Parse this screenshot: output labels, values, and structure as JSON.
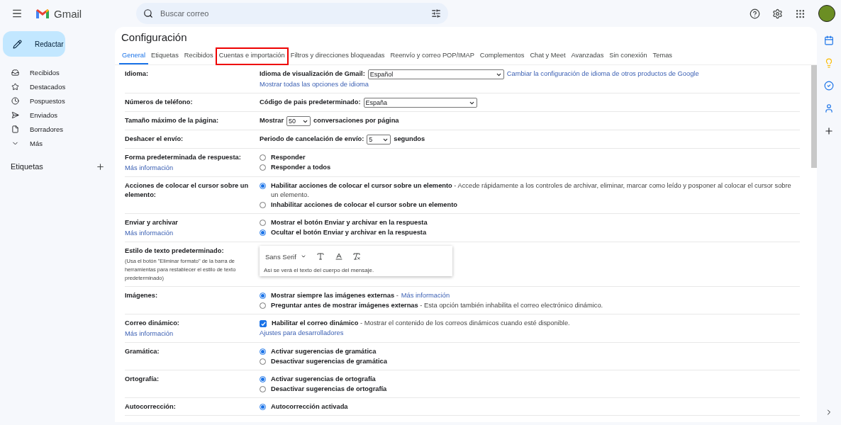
{
  "topbar": {
    "brand": "Gmail",
    "search": {
      "placeholder": "Buscar correo"
    }
  },
  "sidebar": {
    "compose": "Redactar",
    "items": [
      {
        "label": "Recibidos",
        "selected": false
      },
      {
        "label": "Destacados",
        "selected": false
      },
      {
        "label": "Pospuestos",
        "selected": false
      },
      {
        "label": "Enviados",
        "selected": false
      },
      {
        "label": "Borradores",
        "selected": false
      },
      {
        "label": "Más",
        "selected": false
      }
    ],
    "labels_heading": "Etiquetas"
  },
  "settings": {
    "title": "Configuración",
    "tabs": [
      {
        "label": "General",
        "selected": true,
        "highlighted": false
      },
      {
        "label": "Etiquetas",
        "selected": false,
        "highlighted": false
      },
      {
        "label": "Recibidos",
        "selected": false,
        "highlighted": false
      },
      {
        "label": "Cuentas e importación",
        "selected": false,
        "highlighted": true
      },
      {
        "label": "Filtros y direcciones bloqueadas",
        "selected": false,
        "highlighted": false
      },
      {
        "label": "Reenvío y correo POP/IMAP",
        "selected": false,
        "highlighted": false
      },
      {
        "label": "Complementos",
        "selected": false,
        "highlighted": false
      },
      {
        "label": "Chat y Meet",
        "selected": false,
        "highlighted": false
      },
      {
        "label": "Avanzadas",
        "selected": false,
        "highlighted": false
      },
      {
        "label": "Sin conexión",
        "selected": false,
        "highlighted": false
      },
      {
        "label": "Temas",
        "selected": false,
        "highlighted": false
      }
    ],
    "rows": [
      {
        "label": "Idioma:",
        "items": [
          {
            "kind": "select",
            "label": "Idioma de visualización de Gmail:",
            "value": "Español",
            "link": "Cambiar la configuración de idioma de otros productos de Google"
          },
          {
            "kind": "link",
            "text": "Mostrar todas las opciones de idioma"
          }
        ]
      },
      {
        "label": "Números de teléfono:",
        "items": [
          {
            "kind": "select",
            "label": "Código de pais predeterminado:",
            "value": "España"
          }
        ]
      },
      {
        "label": "Tamaño máximo de la página:",
        "items": [
          {
            "kind": "select",
            "label": "Mostrar",
            "value": "50",
            "suffix": "conversaciones por página"
          }
        ]
      },
      {
        "label": "Deshacer el envío:",
        "items": [
          {
            "kind": "select",
            "label": "Periodo de cancelación de envío:",
            "value": "5",
            "suffix": "segundos"
          }
        ]
      },
      {
        "label": "Forma predeterminada de respuesta:",
        "link": "Más información",
        "items": [
          {
            "kind": "radio",
            "label": "Responder",
            "selected": false
          },
          {
            "kind": "radio",
            "label": "Responder a todos",
            "selected": false
          }
        ]
      },
      {
        "label": "Acciones de colocar el cursor sobre un elemento:",
        "items": [
          {
            "kind": "radio",
            "label": "Habilitar acciones de colocar el cursor sobre un elemento",
            "description": "- Accede rápidamente a los controles de archivar, eliminar, marcar como leído y posponer al colocar el cursor sobre un elemento.",
            "selected": true
          },
          {
            "kind": "radio",
            "label": "Inhabilitar acciones de colocar el cursor sobre un elemento",
            "selected": false
          }
        ]
      },
      {
        "label": "Enviar y archivar",
        "link": "Más información",
        "items": [
          {
            "kind": "radio",
            "label": "Mostrar el botón Enviar y archivar en la respuesta",
            "selected": false
          },
          {
            "kind": "radio",
            "label": "Ocultar el botón Enviar y archivar en la respuesta",
            "selected": true
          }
        ]
      },
      {
        "label": "Estilo de texto predeterminado:",
        "note": "(Usa el botón \"Eliminar formato\" de la barra de herramientas para restablecer el estilo de texto predeterminado)",
        "items": [
          {
            "kind": "editor",
            "font": "Sans Serif",
            "sample": "Así se verá el texto del cuerpo del mensaje."
          }
        ]
      },
      {
        "label": "Imágenes:",
        "items": [
          {
            "kind": "radio",
            "label": "Mostrar siempre las imágenes externas",
            "description": "-",
            "link": "Más información",
            "selected": true
          },
          {
            "kind": "radio",
            "label": "Preguntar antes de mostrar imágenes externas",
            "description": "- Esta opción también inhabilita el correo electrónico dinámico.",
            "selected": false
          }
        ]
      },
      {
        "label": "Correo dinámico:",
        "link": "Más información",
        "items": [
          {
            "kind": "checkbox",
            "label": "Habilitar el correo dinámico",
            "description": "- Mostrar el contenido de los correos dinámicos cuando esté disponible.",
            "checked": true
          },
          {
            "kind": "link",
            "text": "Ajustes para desarrolladores"
          }
        ]
      },
      {
        "label": "Gramática:",
        "items": [
          {
            "kind": "radio",
            "label": "Activar sugerencias de gramática",
            "selected": true
          },
          {
            "kind": "radio",
            "label": "Desactivar sugerencias de gramática",
            "selected": false
          }
        ]
      },
      {
        "label": "Ortografía:",
        "items": [
          {
            "kind": "radio",
            "label": "Activar sugerencias de ortografía",
            "selected": true
          },
          {
            "kind": "radio",
            "label": "Desactivar sugerencias de ortografía",
            "selected": false
          }
        ]
      },
      {
        "label": "Autocorrección:",
        "items": [
          {
            "kind": "radio",
            "label": "Autocorrección activada",
            "selected": true
          }
        ]
      }
    ]
  }
}
